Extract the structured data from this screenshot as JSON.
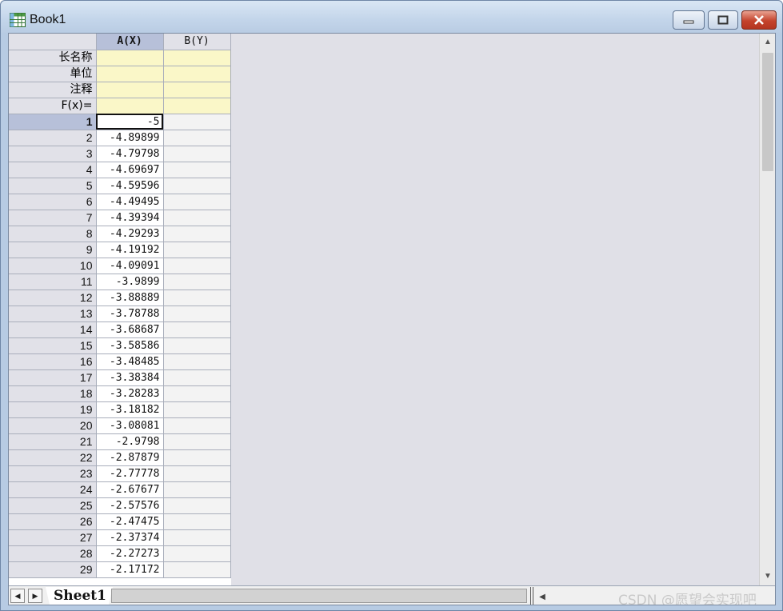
{
  "window": {
    "title": "Book1"
  },
  "grid": {
    "columns": [
      {
        "label": "A(X)",
        "selected": true
      },
      {
        "label": "B(Y)",
        "selected": false
      }
    ],
    "label_rows": [
      "长名称",
      "单位",
      "注释",
      "F(x)="
    ],
    "rows": [
      {
        "n": "1",
        "a": "-5"
      },
      {
        "n": "2",
        "a": "-4.89899"
      },
      {
        "n": "3",
        "a": "-4.79798"
      },
      {
        "n": "4",
        "a": "-4.69697"
      },
      {
        "n": "5",
        "a": "-4.59596"
      },
      {
        "n": "6",
        "a": "-4.49495"
      },
      {
        "n": "7",
        "a": "-4.39394"
      },
      {
        "n": "8",
        "a": "-4.29293"
      },
      {
        "n": "9",
        "a": "-4.19192"
      },
      {
        "n": "10",
        "a": "-4.09091"
      },
      {
        "n": "11",
        "a": "-3.9899"
      },
      {
        "n": "12",
        "a": "-3.88889"
      },
      {
        "n": "13",
        "a": "-3.78788"
      },
      {
        "n": "14",
        "a": "-3.68687"
      },
      {
        "n": "15",
        "a": "-3.58586"
      },
      {
        "n": "16",
        "a": "-3.48485"
      },
      {
        "n": "17",
        "a": "-3.38384"
      },
      {
        "n": "18",
        "a": "-3.28283"
      },
      {
        "n": "19",
        "a": "-3.18182"
      },
      {
        "n": "20",
        "a": "-3.08081"
      },
      {
        "n": "21",
        "a": "-2.9798"
      },
      {
        "n": "22",
        "a": "-2.87879"
      },
      {
        "n": "23",
        "a": "-2.77778"
      },
      {
        "n": "24",
        "a": "-2.67677"
      },
      {
        "n": "25",
        "a": "-2.57576"
      },
      {
        "n": "26",
        "a": "-2.47475"
      },
      {
        "n": "27",
        "a": "-2.37374"
      },
      {
        "n": "28",
        "a": "-2.27273"
      },
      {
        "n": "29",
        "a": "-2.17172"
      }
    ],
    "active_row": "1"
  },
  "sheets": {
    "tabs": [
      "Sheet1"
    ]
  },
  "watermark": "CSDN @愿望会实现吧",
  "colors": {
    "selected_header": "#b7c0d9",
    "meta_rows": "#faf7c8",
    "close_button": "#c4432c"
  },
  "icons": {
    "app": "worksheet-icon",
    "minimize": "minimize-icon",
    "maximize": "maximize-icon",
    "close": "close-icon"
  }
}
